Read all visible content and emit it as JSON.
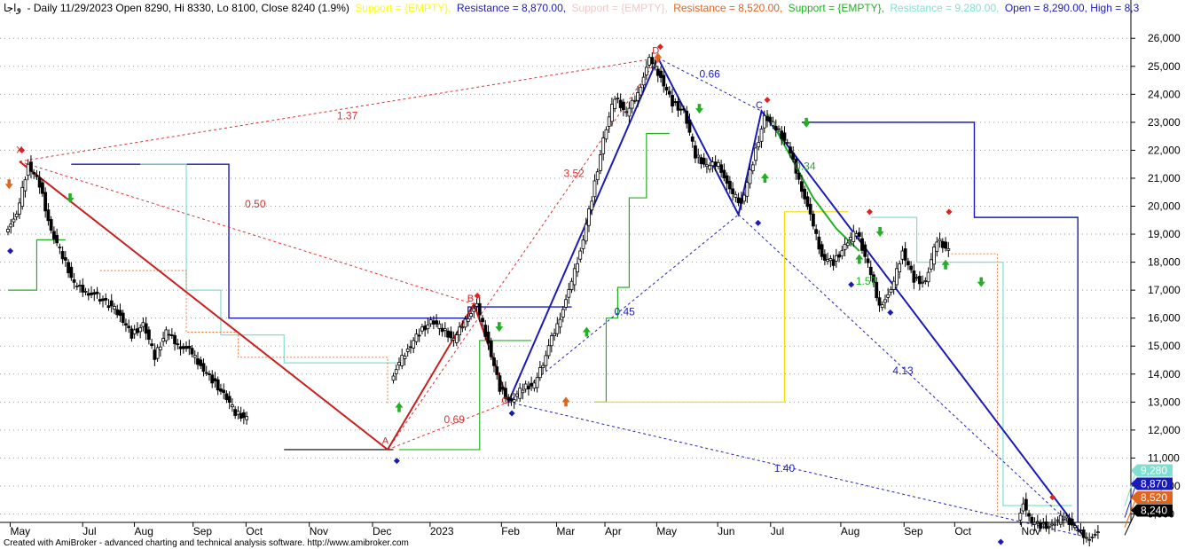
{
  "header": {
    "symbol": "واجا",
    "info": "- Daily 11/29/2023 Open 8290, Hi 8330, Lo 8100, Close 8240 (1.9%)",
    "segments": [
      {
        "text": "Support = {EMPTY},",
        "color": "#ffff00"
      },
      {
        "text": "Resistance = 8,870.00,",
        "color": "#1a1ab8"
      },
      {
        "text": "Support = {EMPTY},",
        "color": "#f0c8c8"
      },
      {
        "text": "Resistance = 8,520.00,",
        "color": "#e2631d"
      },
      {
        "text": "Support = {EMPTY},",
        "color": "#22b022"
      },
      {
        "text": "Resistance = 9,280.00,",
        "color": "#7fe0d0"
      },
      {
        "text": "Open = 8,290.00, High = 8,3",
        "color": "#1a1ab8"
      }
    ]
  },
  "footer": "Created with AmiBroker - advanced charting and technical analysis software. http://www.amibroker.com",
  "chart_data": {
    "type": "candlestick",
    "ylim": [
      8000,
      26500
    ],
    "y_ticks": [
      9000,
      10000,
      11000,
      12000,
      13000,
      14000,
      15000,
      16000,
      17000,
      18000,
      19000,
      20000,
      21000,
      22000,
      23000,
      24000,
      25000,
      26000
    ],
    "y_tick_labels": [
      "9,000",
      "10,000",
      "11,000",
      "12,000",
      "13,000",
      "14,000",
      "15,000",
      "16,000",
      "17,000",
      "18,000",
      "19,000",
      "20,000",
      "21,000",
      "22,000",
      "23,000",
      "24,000",
      "25,000",
      "26,000"
    ],
    "x_labels": [
      {
        "label": "May",
        "t": 0.5
      },
      {
        "label": "Jul",
        "t": 6.8
      },
      {
        "label": "Aug",
        "t": 11.3
      },
      {
        "label": "Sep",
        "t": 16.4
      },
      {
        "label": "Oct",
        "t": 21.0
      },
      {
        "label": "Nov",
        "t": 26.5
      },
      {
        "label": "Dec",
        "t": 32.0
      },
      {
        "label": "2023",
        "t": 37.0
      },
      {
        "label": "Feb",
        "t": 43.2
      },
      {
        "label": "Mar",
        "t": 48.0
      },
      {
        "label": "Apr",
        "t": 52.2
      },
      {
        "label": "May",
        "t": 56.7
      },
      {
        "label": "Jun",
        "t": 62.0
      },
      {
        "label": "Jul",
        "t": 66.6
      },
      {
        "label": "Aug",
        "t": 72.7
      },
      {
        "label": "Sep",
        "t": 78.2
      },
      {
        "label": "Oct",
        "t": 82.6
      },
      {
        "label": "Nov",
        "t": 88.4
      }
    ],
    "price_path": [
      [
        0,
        19200
      ],
      [
        1,
        19600
      ],
      [
        2,
        21500
      ],
      [
        3,
        20800
      ],
      [
        4,
        19100
      ],
      [
        5,
        18200
      ],
      [
        6,
        17200
      ],
      [
        7,
        17000
      ],
      [
        9,
        16500
      ],
      [
        10,
        16100
      ],
      [
        11,
        15400
      ],
      [
        12,
        15800
      ],
      [
        13,
        14600
      ],
      [
        14,
        15500
      ],
      [
        15,
        15100
      ],
      [
        16,
        14800
      ],
      [
        17,
        14300
      ],
      [
        18,
        13800
      ],
      [
        19,
        13300
      ],
      [
        20,
        12600
      ],
      [
        21,
        12400
      ],
      [
        33.5,
        13900
      ],
      [
        34,
        14200
      ],
      [
        35,
        14900
      ],
      [
        36,
        15500
      ],
      [
        37,
        15900
      ],
      [
        38,
        15600
      ],
      [
        39,
        15200
      ],
      [
        40,
        16000
      ],
      [
        41,
        16400
      ],
      [
        42,
        15100
      ],
      [
        43,
        13500
      ],
      [
        44,
        13000
      ],
      [
        45,
        13500
      ],
      [
        46,
        13600
      ],
      [
        48,
        15800
      ],
      [
        49,
        16900
      ],
      [
        50,
        18400
      ],
      [
        51,
        20300
      ],
      [
        52,
        22400
      ],
      [
        53,
        23900
      ],
      [
        54,
        23300
      ],
      [
        55,
        24100
      ],
      [
        56,
        25200
      ],
      [
        57,
        24600
      ],
      [
        58,
        23700
      ],
      [
        59,
        23400
      ],
      [
        60,
        21800
      ],
      [
        61,
        21400
      ],
      [
        62,
        21600
      ],
      [
        63,
        20500
      ],
      [
        64,
        20100
      ],
      [
        65,
        21600
      ],
      [
        66,
        23200
      ],
      [
        67,
        22800
      ],
      [
        68,
        22200
      ],
      [
        69,
        21000
      ],
      [
        70,
        19600
      ],
      [
        71,
        18200
      ],
      [
        72,
        18000
      ],
      [
        73,
        18600
      ],
      [
        74,
        19100
      ],
      [
        75,
        17900
      ],
      [
        76,
        16500
      ],
      [
        77,
        16900
      ],
      [
        78,
        18400
      ],
      [
        79,
        17400
      ],
      [
        80,
        17300
      ],
      [
        81,
        18800
      ],
      [
        82,
        18400
      ],
      [
        88,
        8900
      ],
      [
        88.5,
        9400
      ],
      [
        89,
        8800
      ],
      [
        90,
        8600
      ],
      [
        91,
        8600
      ],
      [
        92,
        8900
      ],
      [
        93,
        8500
      ],
      [
        94,
        8200
      ],
      [
        95,
        8240
      ]
    ],
    "pattern_red": {
      "points": [
        [
          1,
          21600
        ],
        [
          33,
          11300
        ],
        [
          40.5,
          16500
        ],
        [
          43.5,
          13000
        ]
      ],
      "labels": [
        "X",
        "A",
        "B",
        "C"
      ]
    },
    "pattern_blue": {
      "points": [
        [
          43.5,
          13000
        ],
        [
          56.5,
          25300
        ],
        [
          63.5,
          19700
        ],
        [
          65.5,
          23400
        ],
        [
          93.5,
          8200
        ]
      ],
      "labels": [
        "",
        "D",
        "",
        "C",
        ""
      ]
    },
    "ratio_labels": [
      {
        "text": "1.37",
        "t": 29.5,
        "y": 23100,
        "color": "#e03030"
      },
      {
        "text": "0.50",
        "t": 21.5,
        "y": 19950,
        "color": "#e03030"
      },
      {
        "text": "3.52",
        "t": 49.2,
        "y": 21050,
        "color": "#e03030"
      },
      {
        "text": "0.69",
        "t": 38.8,
        "y": 12250,
        "color": "#e03030"
      },
      {
        "text": "0.66",
        "t": 61.0,
        "y": 24600,
        "color": "#2020c0"
      },
      {
        "text": "0.45",
        "t": 53.6,
        "y": 16100,
        "color": "#2020c0"
      },
      {
        "text": "0.34",
        "t": 69.3,
        "y": 21300,
        "color": "#22b022"
      },
      {
        "text": "1.57",
        "t": 74.6,
        "y": 17200,
        "color": "#22b022"
      },
      {
        "text": "4.13",
        "t": 77.8,
        "y": 14000,
        "color": "#2020c0"
      },
      {
        "text": "1.40",
        "t": 67.5,
        "y": 10500,
        "color": "#2020c0"
      }
    ],
    "point_labels": [
      {
        "text": "X",
        "t": 1.0,
        "y": 21900,
        "color": "#d02020"
      },
      {
        "text": "A",
        "t": 32.8,
        "y": 11500,
        "color": "#d02020"
      },
      {
        "text": "B",
        "t": 40.2,
        "y": 16600,
        "color": "#d02020"
      },
      {
        "text": "C",
        "t": 43.2,
        "y": 12950,
        "color": "#d02020"
      },
      {
        "text": "D",
        "t": 56.3,
        "y": 25450,
        "color": "#d02020"
      },
      {
        "text": "C",
        "t": 65.3,
        "y": 23500,
        "color": "#2020c0"
      }
    ],
    "price_badges": [
      {
        "label": "9,280",
        "value": 9280,
        "color": "#7fe0d0",
        "text_color": "#000000"
      },
      {
        "label": "8,870",
        "value": 8870,
        "color": "#1a1ab8",
        "text_color": "#ffffff"
      },
      {
        "label": "8,520",
        "value": 8520,
        "color": "#e2631d",
        "text_color": "#ffffff"
      },
      {
        "label": "8,240",
        "value": 8240,
        "color": "#000000",
        "text_color": "#ffffff"
      }
    ]
  }
}
